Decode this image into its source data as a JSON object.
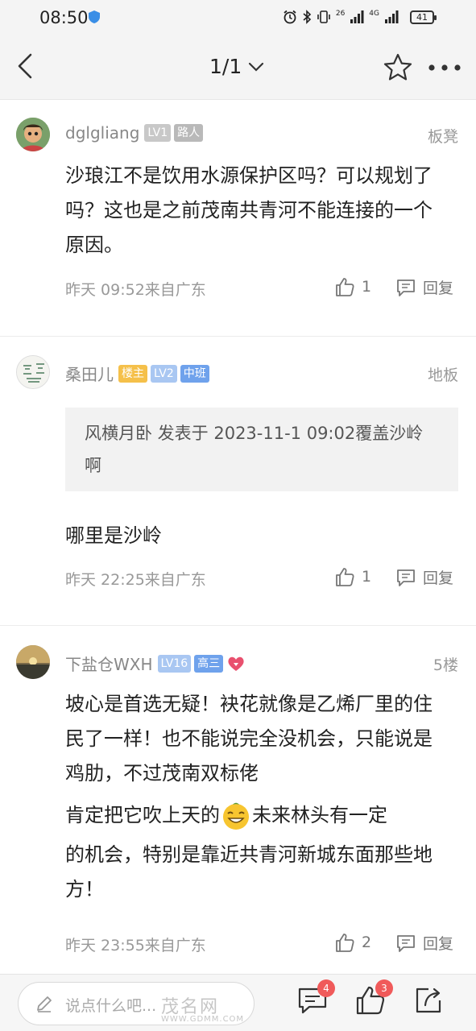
{
  "status_bar": {
    "time": "08:50",
    "network_labels": [
      "26",
      "4G"
    ],
    "battery": "41"
  },
  "nav": {
    "page_indicator": "1/1"
  },
  "posts": [
    {
      "username": "dglgliang",
      "level": "LV1",
      "title": "路人",
      "floor": "板凳",
      "content": "沙琅江不是饮用水源保护区吗？可以规划了吗？这也是之前茂南共青河不能连接的一个原因。",
      "timestamp": "昨天 09:52来自广东",
      "likes": "1",
      "reply_label": "回复"
    },
    {
      "username": "桑田儿",
      "op_badge": "楼主",
      "level": "LV2",
      "title": "中班",
      "floor": "地板",
      "quote": "风横月卧 发表于 2023-11-1 09:02覆盖沙岭啊",
      "content": "哪里是沙岭",
      "timestamp": "昨天 22:25来自广东",
      "likes": "1",
      "reply_label": "回复"
    },
    {
      "username": "下盐仓WXH",
      "level": "LV16",
      "title": "高三",
      "floor": "5楼",
      "content_line1": "坡心是首选无疑！袂花就像是乙烯厂里的住民了一样！也不能说完全没机会，只能说是鸡肋，不过茂南双标佬",
      "content_line2a": "肯定把它吹上天的",
      "content_line2b": "未来林头有一定",
      "content_line3": "的机会，特别是靠近共青河新城东面那些地方！",
      "timestamp": "昨天 23:55来自广东",
      "likes": "2",
      "reply_label": "回复"
    }
  ],
  "bottom_bar": {
    "input_placeholder": "说点什么吧...",
    "comment_count": "4",
    "like_count": "3"
  },
  "watermark": {
    "main": "茂名网",
    "sub": "WWW.GDMM.COM"
  }
}
